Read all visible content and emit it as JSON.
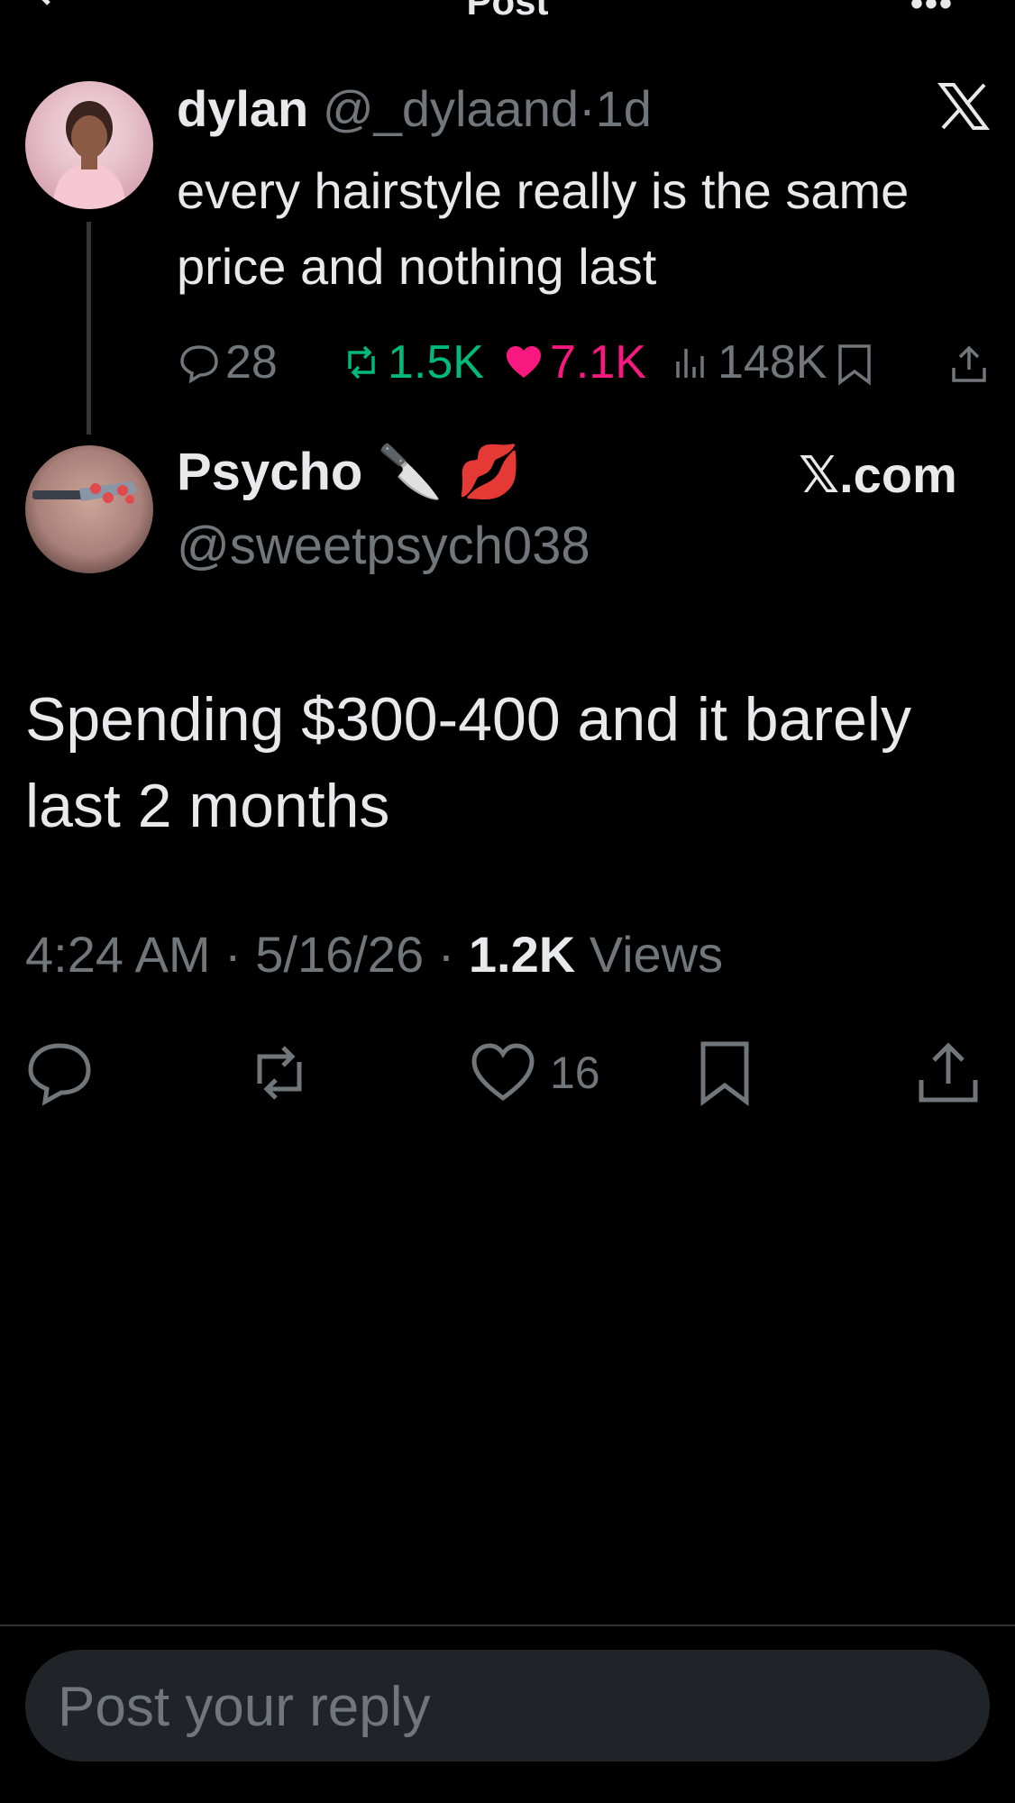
{
  "header": {
    "title": "Post",
    "back_icon": "arrow-left-icon",
    "more_label": "•••"
  },
  "quoted_post": {
    "name": "dylan",
    "handle": "@_dylaand",
    "separator": "·",
    "time": "1d",
    "text": "every hairstyle really is the same price and nothing last",
    "stats": {
      "replies": "28",
      "reposts": "1.5K",
      "likes": "7.1K",
      "views": "148K"
    },
    "watermark_icon": "x-logo-icon"
  },
  "post": {
    "name": "Psycho",
    "emojis": "🔪 💋",
    "handle": "@sweetpsych038",
    "brand": "𝕏.com",
    "text": "Spending $300-400 and it barely last 2 months",
    "time": "4:24 AM",
    "date": "5/16/26",
    "dot": "·",
    "views_count": "1.2K",
    "views_label": "Views",
    "like_count": "16"
  },
  "reply": {
    "placeholder": "Post your reply"
  },
  "colors": {
    "background": "#000000",
    "text": "#e7e9ea",
    "muted": "#71767b",
    "repost": "#00ba7c",
    "like": "#f91880"
  }
}
